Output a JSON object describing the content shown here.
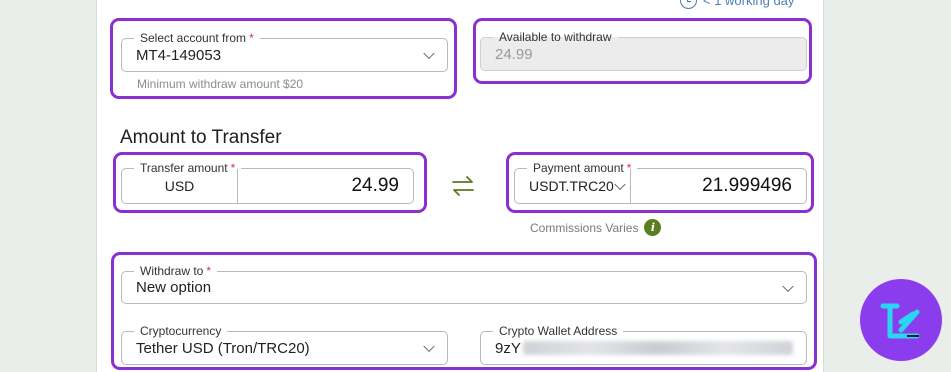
{
  "header": {
    "delivery_time": "< 1 working day"
  },
  "account_select": {
    "label": "Select account from",
    "required_mark": "*",
    "value": "MT4-149053",
    "hint": "Minimum withdraw amount $20"
  },
  "available": {
    "label": "Available to withdraw",
    "value": "24.99"
  },
  "amount_section": {
    "title": "Amount to Transfer"
  },
  "transfer_amount": {
    "label": "Transfer amount",
    "required_mark": "*",
    "currency": "USD",
    "value": "24.99"
  },
  "payment_amount": {
    "label": "Payment amount",
    "required_mark": "*",
    "currency": "USDT.TRC20",
    "value": "21.999496"
  },
  "commissions": {
    "label": "Commissions Varies",
    "icon": "info-icon"
  },
  "withdraw_to": {
    "label": "Withdraw to",
    "required_mark": "*",
    "value": "New option"
  },
  "cryptocurrency": {
    "label": "Cryptocurrency",
    "value": "Tether USD (Tron/TRC20)"
  },
  "wallet": {
    "label": "Crypto Wallet Address",
    "value_prefix": "9zY"
  },
  "colors": {
    "highlight": "#8a2fd0",
    "logo_bg": "#8b3dee",
    "logo_accent": "#28d7ef",
    "info_green": "#5a7f1e",
    "swap_arrows": "#5f7a1d"
  },
  "logo": {
    "name": "brand-logo-icon"
  }
}
